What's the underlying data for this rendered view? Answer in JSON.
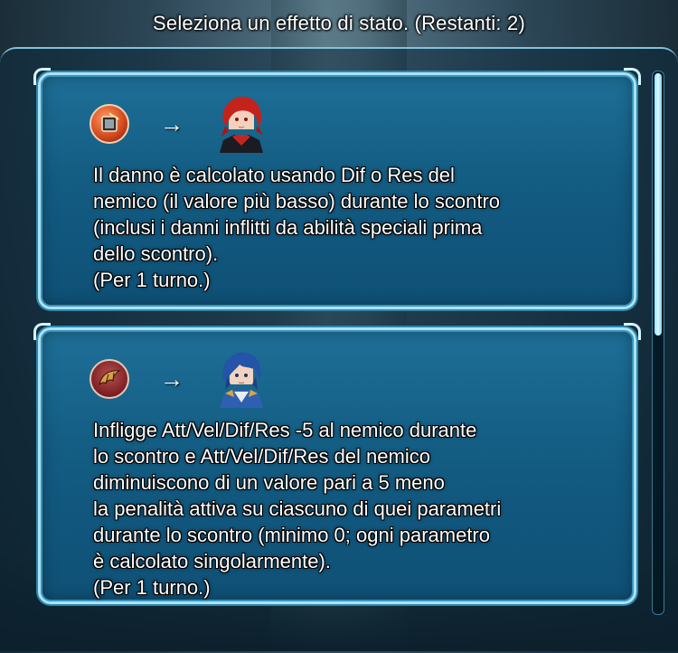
{
  "header": {
    "title": "Seleziona un effetto di stato. (Restanti: 2)"
  },
  "effects": [
    {
      "icon": "flaming-book-status-icon",
      "arrow": "→",
      "target": "red-haired-hero-portrait",
      "lines": [
        "Il danno è calcolato usando Dif o Res del",
        "nemico (il valore più basso) durante lo scontro",
        "(inclusi i danni inflitti da abilità speciali prima",
        "dello scontro).",
        "(Per 1 turno.)"
      ]
    },
    {
      "icon": "dragon-wing-status-icon",
      "arrow": "→",
      "target": "blue-haired-hero-portrait",
      "lines": [
        "Infligge Att/Vel/Dif/Res -5 al nemico durante",
        "lo scontro e Att/Vel/Dif/Res del nemico",
        "diminuiscono di un valore pari a 5 meno",
        "la penalità attiva su ciascuno di quei parametri",
        "durante lo scontro (minimo 0; ogni parametro",
        "è calcolato singolarmente).",
        "(Per 1 turno.)"
      ]
    }
  ],
  "colors": {
    "card_border": "#a8e4f5",
    "card_fill": "#135c82",
    "text": "#ffffff"
  }
}
